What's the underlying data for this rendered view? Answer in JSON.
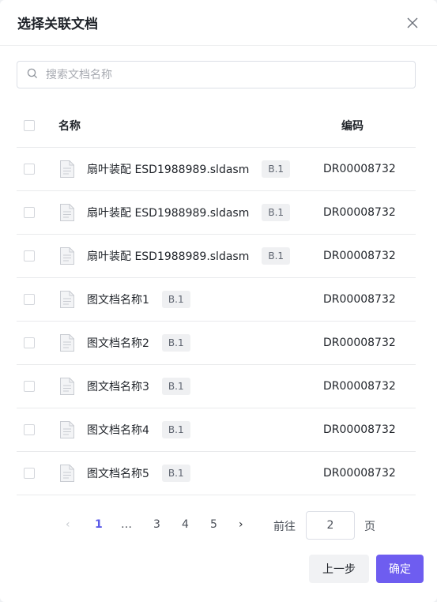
{
  "dialog": {
    "title": "选择关联文档",
    "search_placeholder": "搜索文档名称",
    "table": {
      "header_name": "名称",
      "header_code": "编码",
      "rows": [
        {
          "name": "扇叶装配 ESD1988989.sldasm",
          "version": "B.1",
          "code": "DR00008732"
        },
        {
          "name": "扇叶装配 ESD1988989.sldasm",
          "version": "B.1",
          "code": "DR00008732"
        },
        {
          "name": "扇叶装配 ESD1988989.sldasm",
          "version": "B.1",
          "code": "DR00008732"
        },
        {
          "name": "图文档名称1",
          "version": "B.1",
          "code": "DR00008732"
        },
        {
          "name": "图文档名称2",
          "version": "B.1",
          "code": "DR00008732"
        },
        {
          "name": "图文档名称3",
          "version": "B.1",
          "code": "DR00008732"
        },
        {
          "name": "图文档名称4",
          "version": "B.1",
          "code": "DR00008732"
        },
        {
          "name": "图文档名称5",
          "version": "B.1",
          "code": "DR00008732"
        }
      ]
    },
    "pagination": {
      "prev_arrow": "‹",
      "next_arrow": "›",
      "pages": [
        "1",
        "…",
        "3",
        "4",
        "5"
      ],
      "current_page": "1",
      "goto_label": "前往",
      "goto_value": "2",
      "page_unit": "页"
    },
    "buttons": {
      "prev": "上一步",
      "confirm": "确定"
    }
  },
  "colors": {
    "accent": "#6e5df0",
    "active_page": "#5b5be8"
  },
  "icons": [
    "close-icon",
    "search-icon",
    "document-icon",
    "chevron-left-icon",
    "chevron-right-icon"
  ]
}
